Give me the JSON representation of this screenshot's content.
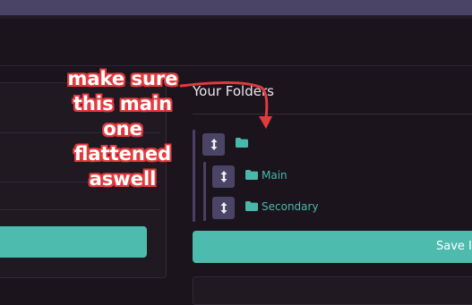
{
  "section": {
    "title": "Your Folders"
  },
  "tree": {
    "root": {
      "handle_icon": "drag-handle-icon",
      "folder_icon": "folder-icon",
      "label": ""
    },
    "children": [
      {
        "handle_icon": "drag-handle-icon",
        "folder_icon": "folder-icon",
        "label": "Main"
      },
      {
        "handle_icon": "drag-handle-icon",
        "folder_icon": "folder-icon",
        "label": "Secondary"
      }
    ]
  },
  "actions": {
    "save_label": "Save I"
  },
  "annotation": {
    "lines": [
      "make sure",
      "this main",
      "one",
      "flattened",
      "aswell"
    ]
  },
  "colors": {
    "background": "#1b141c",
    "accent": "#4dbcaf",
    "folder": "#49b8ab",
    "handle": "#4a4466",
    "annotation_stroke": "#e33a3d"
  }
}
